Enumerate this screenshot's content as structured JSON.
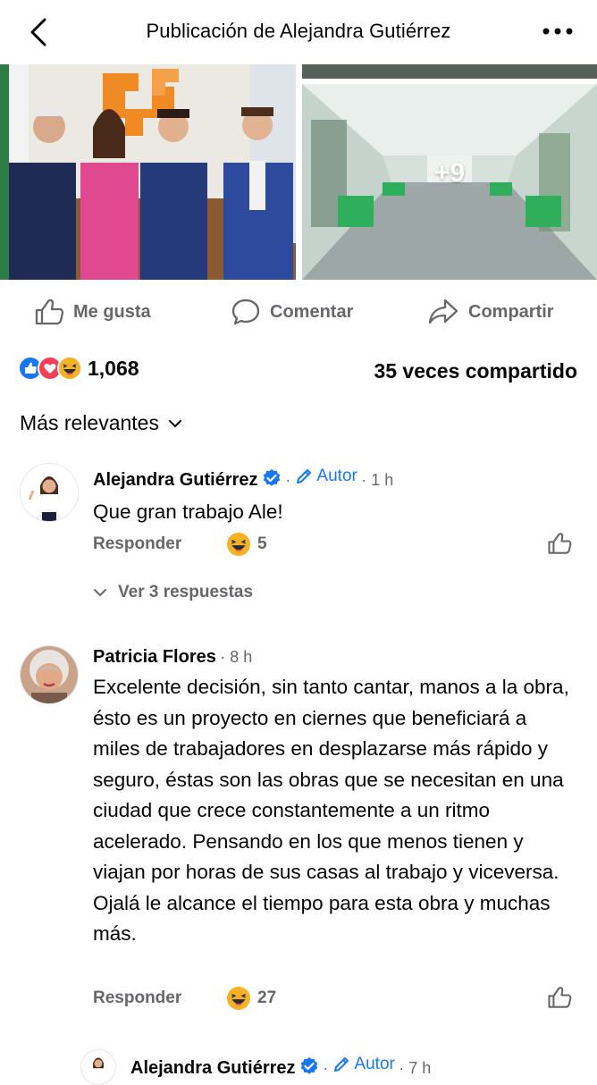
{
  "header": {
    "title": "Publicación de Alejandra Gutiérrez"
  },
  "media": {
    "extra_count": "+9"
  },
  "actions": {
    "like": "Me gusta",
    "comment": "Comentar",
    "share": "Compartir"
  },
  "stats": {
    "reactions_count": "1,068",
    "shares": "35 veces compartido"
  },
  "sort": {
    "label": "Más relevantes"
  },
  "comments": [
    {
      "name": "Alejandra Gutiérrez",
      "badge": "Autor",
      "time": "1 h",
      "text": "Que gran trabajo Ale!",
      "reply_label": "Responder",
      "reaction_count": "5",
      "view_replies": "Ver 3 respuestas"
    },
    {
      "name": "Patricia Flores",
      "time": "8 h",
      "text": "Excelente decisión, sin tanto cantar, manos a la obra, ésto es un proyecto en ciernes que beneficiará a miles de trabajadores en desplazarse más rápido y seguro, éstas son las obras que se necesitan en una ciudad que crece constantemente a un ritmo acelerado. Pensando en los que menos tienen y viajan por horas de sus casas al trabajo y viceversa. Ojalá le alcance el tiempo para esta obra y muchas más.",
      "reply_label": "Responder",
      "reaction_count": "27"
    },
    {
      "name": "Alejandra Gutiérrez",
      "badge": "Autor",
      "time": "7 h"
    }
  ],
  "colors": {
    "accent": "#1877f2",
    "secondary_text": "#65676b",
    "love": "#f33e58",
    "haha": "#f7b125"
  }
}
